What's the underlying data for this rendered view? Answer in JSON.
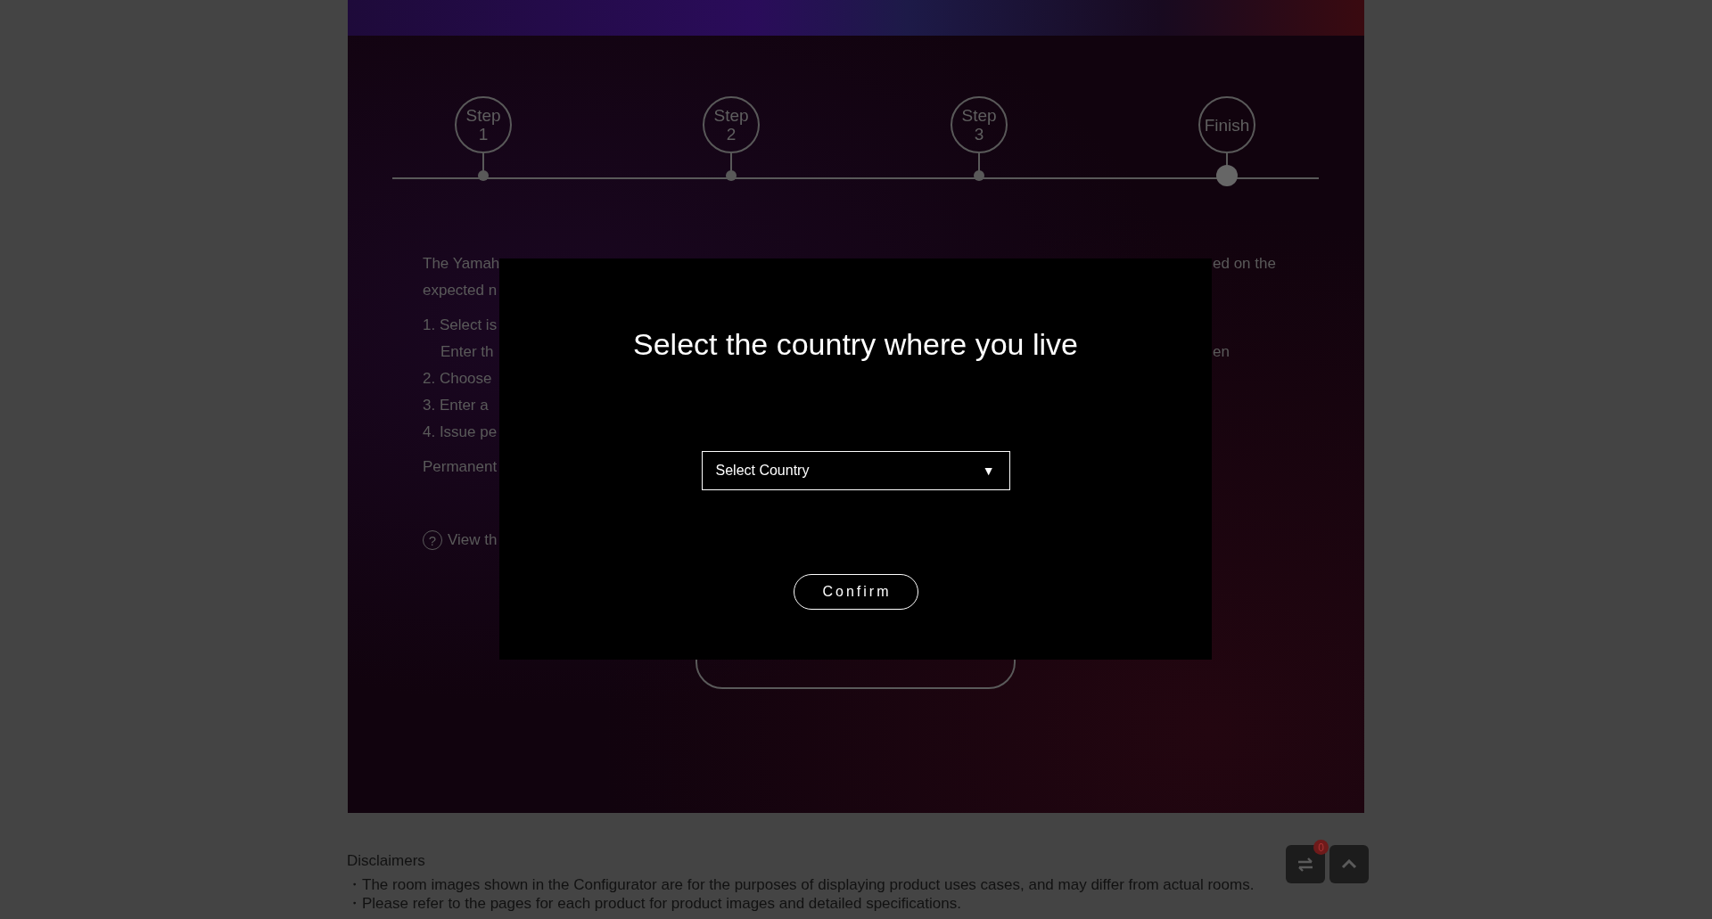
{
  "steps": [
    {
      "label": "Step 1",
      "selected": false
    },
    {
      "label": "Step 2",
      "selected": false
    },
    {
      "label": "Step 3",
      "selected": false
    },
    {
      "label": "Finish",
      "selected": true
    }
  ],
  "description": [
    {
      "left": "The Yamah",
      "right": "ed on the"
    },
    {
      "left": "expected n"
    }
  ],
  "instructions": [
    {
      "kind": "item",
      "left": "1. Select is"
    },
    {
      "kind": "continuation",
      "left": "Enter th",
      "right": "en"
    },
    {
      "kind": "item",
      "left": "2. Choose"
    },
    {
      "kind": "item",
      "left": "3. Enter a"
    },
    {
      "kind": "item",
      "left": "4. Issue pe"
    }
  ],
  "note": "Permanent",
  "help_link": {
    "icon": "?",
    "text": "View th"
  },
  "modal": {
    "title": "Select the country where you live",
    "select": {
      "value": "Select Country",
      "arrow": "▼"
    },
    "confirm_button": "Confirm"
  },
  "disclaimers": {
    "title": "Disclaimers",
    "items": [
      "・The room images shown in the Configurator are for the purposes of displaying product uses cases, and may differ from actual rooms.",
      "・Please refer to the pages for each product for product images and detailed specifications."
    ]
  },
  "compare_badge": "0"
}
